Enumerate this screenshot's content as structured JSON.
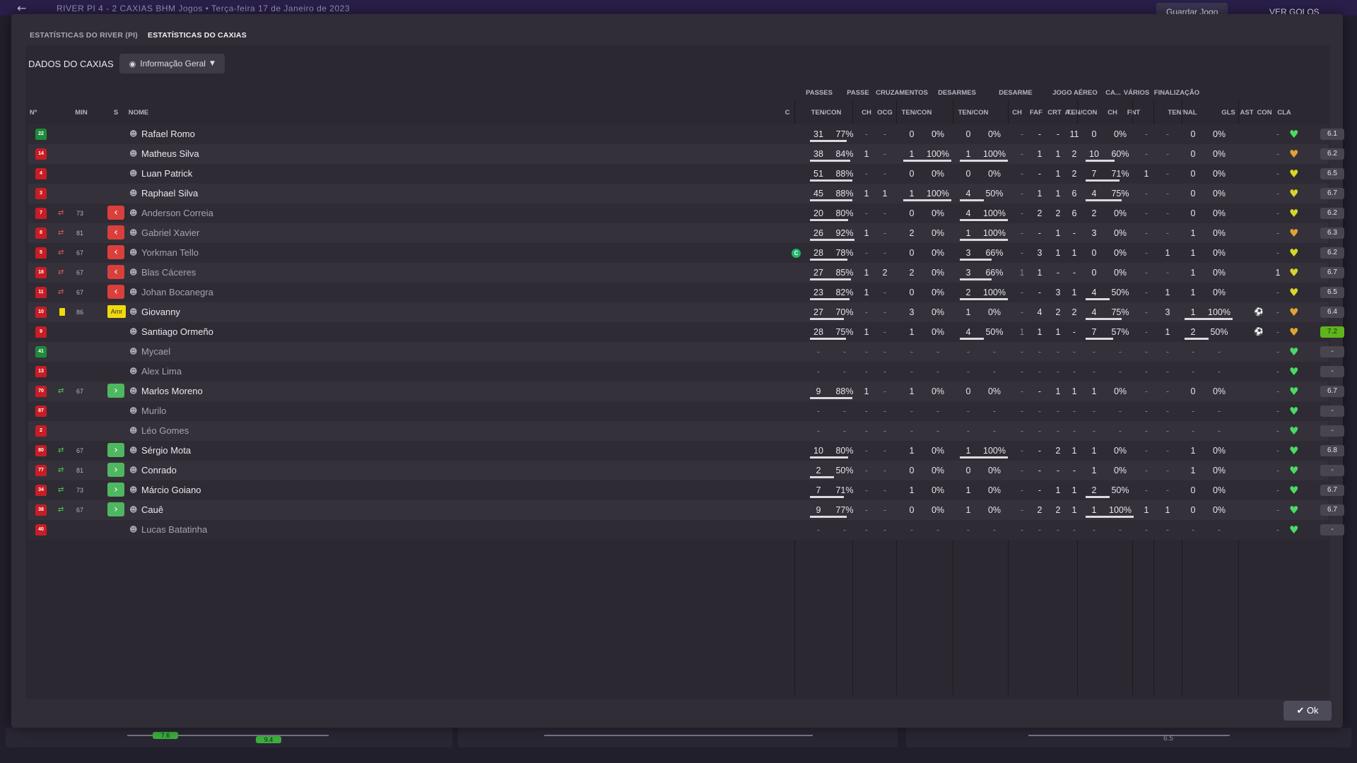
{
  "topbar": {
    "back_glyph": "←",
    "match": "RIVER PI  4 - 2  CAXIAS   BHM Jogos   •   Terça-feira 17 de Janeiro de 2023",
    "save_label": "Guardar Jogo",
    "goals_label": "VER GOLOS"
  },
  "tabs": [
    "ESTATÍSTICAS DO RIVER (PI)",
    "ESTATÍSTICAS DO CAXIAS"
  ],
  "subheader": {
    "title": "DADOS DO CAXIAS",
    "view_select": "Informação Geral"
  },
  "groups": [
    "PASSES",
    "PASSE",
    "CRUZAMENTOS",
    "DESARMES",
    "DESARME",
    "JOGO AÉREO",
    "CA...",
    "VÁRIOS",
    "FINALIZAÇÃO"
  ],
  "headers": {
    "no": "Nº",
    "min": "MIN",
    "s": "S",
    "name": "NOME",
    "c": "C",
    "passes_tc": "TEN/CON",
    "passe_ch": "CH",
    "passe_ocg": "OCG",
    "cruz_tc": "TEN/CON",
    "des_tc": "TEN/CON",
    "d_ch": "CH",
    "d_faf": "FAF",
    "d_crt": "CRT",
    "d_a": "A...",
    "aer_tc": "TEN/CON",
    "ca_ch": "CH",
    "var_fnt": "FNT",
    "fin_tn": "TEN/NAL",
    "gls": "GLS",
    "ast": "AST",
    "con": "CON",
    "cla": "CLA"
  },
  "players": [
    {
      "num": "22",
      "shirt": "green",
      "sub": "",
      "min": "",
      "s": "",
      "name": "Rafael Romo",
      "cap": false,
      "pass": [
        "31",
        "77%"
      ],
      "pch": "-",
      "pocg": "-",
      "cruz": [
        "0",
        "0%"
      ],
      "des": [
        "0",
        "0%"
      ],
      "dch": "-",
      "dfaf": "-",
      "dcrt": "-",
      "da": "11",
      "aer": [
        "0",
        "0%"
      ],
      "cach": "-",
      "fnt": "-",
      "fin": [
        "0",
        "0%"
      ],
      "gls": "",
      "ast": "-",
      "con": "green",
      "cla": "6.1",
      "active": true
    },
    {
      "num": "14",
      "shirt": "red",
      "sub": "",
      "min": "",
      "s": "",
      "name": "Matheus Silva",
      "cap": false,
      "pass": [
        "38",
        "84%"
      ],
      "pch": "1",
      "pocg": "-",
      "cruz": [
        "1",
        "100%"
      ],
      "des": [
        "1",
        "100%"
      ],
      "dch": "-",
      "dfaf": "1",
      "dcrt": "1",
      "da": "2",
      "aer": [
        "10",
        "60%"
      ],
      "cach": "-",
      "fnt": "-",
      "fin": [
        "0",
        "0%"
      ],
      "gls": "",
      "ast": "-",
      "con": "orange",
      "cla": "6.2",
      "active": true
    },
    {
      "num": "4",
      "shirt": "red",
      "sub": "",
      "min": "",
      "s": "",
      "name": "Luan Patrick",
      "cap": false,
      "pass": [
        "51",
        "88%"
      ],
      "pch": "-",
      "pocg": "-",
      "cruz": [
        "0",
        "0%"
      ],
      "des": [
        "0",
        "0%"
      ],
      "dch": "-",
      "dfaf": "-",
      "dcrt": "1",
      "da": "2",
      "aer": [
        "7",
        "71%"
      ],
      "cach": "1",
      "fnt": "-",
      "fin": [
        "0",
        "0%"
      ],
      "gls": "",
      "ast": "-",
      "con": "yellow",
      "cla": "6.5",
      "active": true
    },
    {
      "num": "3",
      "shirt": "red",
      "sub": "",
      "min": "",
      "s": "",
      "name": "Raphael Silva",
      "cap": false,
      "pass": [
        "45",
        "88%"
      ],
      "pch": "1",
      "pocg": "1",
      "cruz": [
        "1",
        "100%"
      ],
      "des": [
        "4",
        "50%"
      ],
      "dch": "-",
      "dfaf": "1",
      "dcrt": "1",
      "da": "6",
      "aer": [
        "4",
        "75%"
      ],
      "cach": "-",
      "fnt": "-",
      "fin": [
        "0",
        "0%"
      ],
      "gls": "",
      "ast": "-",
      "con": "yellow",
      "cla": "6.7",
      "active": true
    },
    {
      "num": "7",
      "shirt": "red",
      "sub": "out",
      "min": "73",
      "s": "out",
      "name": "Anderson Correia",
      "cap": false,
      "pass": [
        "20",
        "80%"
      ],
      "pch": "-",
      "pocg": "-",
      "cruz": [
        "0",
        "0%"
      ],
      "des": [
        "4",
        "100%"
      ],
      "dch": "-",
      "dfaf": "2",
      "dcrt": "2",
      "da": "6",
      "aer": [
        "2",
        "0%"
      ],
      "cach": "-",
      "fnt": "-",
      "fin": [
        "0",
        "0%"
      ],
      "gls": "",
      "ast": "-",
      "con": "yellow",
      "cla": "6.2",
      "active": false
    },
    {
      "num": "8",
      "shirt": "red",
      "sub": "out",
      "min": "81",
      "s": "out",
      "name": "Gabriel Xavier",
      "cap": false,
      "pass": [
        "26",
        "92%"
      ],
      "pch": "1",
      "pocg": "-",
      "cruz": [
        "2",
        "0%"
      ],
      "des": [
        "1",
        "100%"
      ],
      "dch": "-",
      "dfaf": "-",
      "dcrt": "1",
      "da": "-",
      "aer": [
        "3",
        "0%"
      ],
      "cach": "-",
      "fnt": "-",
      "fin": [
        "1",
        "0%"
      ],
      "gls": "",
      "ast": "-",
      "con": "orange",
      "cla": "6.3",
      "active": false
    },
    {
      "num": "5",
      "shirt": "red",
      "sub": "out",
      "min": "67",
      "s": "out",
      "name": "Yorkman Tello",
      "cap": true,
      "pass": [
        "28",
        "78%"
      ],
      "pch": "-",
      "pocg": "-",
      "cruz": [
        "0",
        "0%"
      ],
      "des": [
        "3",
        "66%"
      ],
      "dch": "-",
      "dfaf": "3",
      "dcrt": "1",
      "da": "1",
      "aer": [
        "0",
        "0%"
      ],
      "cach": "-",
      "fnt": "1",
      "fin": [
        "1",
        "0%"
      ],
      "gls": "",
      "ast": "-",
      "con": "yellow",
      "cla": "6.2",
      "active": false
    },
    {
      "num": "18",
      "shirt": "red",
      "sub": "out",
      "min": "67",
      "s": "out",
      "name": "Blas Cáceres",
      "cap": false,
      "pass": [
        "27",
        "85%"
      ],
      "pch": "1",
      "pocg": "2",
      "cruz": [
        "2",
        "0%"
      ],
      "des": [
        "3",
        "66%"
      ],
      "dch": "1",
      "dfaf": "1",
      "dcrt": "-",
      "da": "-",
      "aer": [
        "0",
        "0%"
      ],
      "cach": "-",
      "fnt": "-",
      "fin": [
        "1",
        "0%"
      ],
      "gls": "",
      "ast": "1",
      "con": "yellow",
      "cla": "6.7",
      "active": false
    },
    {
      "num": "11",
      "shirt": "red",
      "sub": "out",
      "min": "67",
      "s": "out",
      "name": "Johan Bocanegra",
      "cap": false,
      "pass": [
        "23",
        "82%"
      ],
      "pch": "1",
      "pocg": "-",
      "cruz": [
        "0",
        "0%"
      ],
      "des": [
        "2",
        "100%"
      ],
      "dch": "-",
      "dfaf": "-",
      "dcrt": "3",
      "da": "1",
      "aer": [
        "4",
        "50%"
      ],
      "cach": "-",
      "fnt": "1",
      "fin": [
        "1",
        "0%"
      ],
      "gls": "",
      "ast": "-",
      "con": "yellow",
      "cla": "6.5",
      "active": false
    },
    {
      "num": "10",
      "shirt": "red",
      "sub": "card",
      "min": "86",
      "s": "amr",
      "name": "Giovanny",
      "cap": false,
      "pass": [
        "27",
        "70%"
      ],
      "pch": "-",
      "pocg": "-",
      "cruz": [
        "3",
        "0%"
      ],
      "des": [
        "1",
        "0%"
      ],
      "dch": "-",
      "dfaf": "4",
      "dcrt": "2",
      "da": "2",
      "aer": [
        "4",
        "75%"
      ],
      "cach": "-",
      "fnt": "3",
      "fin": [
        "1",
        "100%"
      ],
      "gls": "ball",
      "ast": "-",
      "con": "orange",
      "cla": "6.4",
      "active": true
    },
    {
      "num": "9",
      "shirt": "red",
      "sub": "",
      "min": "",
      "s": "",
      "name": "Santiago Ormeño",
      "cap": false,
      "pass": [
        "28",
        "75%"
      ],
      "pch": "1",
      "pocg": "-",
      "cruz": [
        "1",
        "0%"
      ],
      "des": [
        "4",
        "50%"
      ],
      "dch": "1",
      "dfaf": "1",
      "dcrt": "1",
      "da": "-",
      "aer": [
        "7",
        "57%"
      ],
      "cach": "-",
      "fnt": "1",
      "fin": [
        "2",
        "50%"
      ],
      "gls": "ball",
      "ast": "-",
      "con": "orange",
      "cla": "7.2",
      "best": true,
      "active": true
    },
    {
      "num": "41",
      "shirt": "green",
      "sub": "",
      "min": "",
      "s": "",
      "name": "Mycael",
      "cap": false,
      "empty": true,
      "con": "green",
      "cla": "-",
      "active": false
    },
    {
      "num": "13",
      "shirt": "red",
      "sub": "",
      "min": "",
      "s": "",
      "name": "Alex Lima",
      "cap": false,
      "empty": true,
      "con": "green",
      "cla": "-",
      "active": false
    },
    {
      "num": "70",
      "shirt": "red",
      "sub": "in",
      "min": "67",
      "s": "in",
      "name": "Marlos Moreno",
      "cap": false,
      "pass": [
        "9",
        "88%"
      ],
      "pch": "1",
      "pocg": "-",
      "cruz": [
        "1",
        "0%"
      ],
      "des": [
        "0",
        "0%"
      ],
      "dch": "-",
      "dfaf": "-",
      "dcrt": "1",
      "da": "1",
      "aer": [
        "1",
        "0%"
      ],
      "cach": "-",
      "fnt": "-",
      "fin": [
        "0",
        "0%"
      ],
      "gls": "",
      "ast": "-",
      "con": "green",
      "cla": "6.7",
      "active": true
    },
    {
      "num": "87",
      "shirt": "red",
      "sub": "",
      "min": "",
      "s": "",
      "name": "Murilo",
      "cap": false,
      "empty": true,
      "con": "green",
      "cla": "-",
      "active": false
    },
    {
      "num": "2",
      "shirt": "red",
      "sub": "",
      "min": "",
      "s": "",
      "name": "Léo Gomes",
      "cap": false,
      "empty": true,
      "con": "green",
      "cla": "-",
      "active": false
    },
    {
      "num": "80",
      "shirt": "red",
      "sub": "in",
      "min": "67",
      "s": "in",
      "name": "Sérgio Mota",
      "cap": false,
      "pass": [
        "10",
        "80%"
      ],
      "pch": "-",
      "pocg": "-",
      "cruz": [
        "1",
        "0%"
      ],
      "des": [
        "1",
        "100%"
      ],
      "dch": "-",
      "dfaf": "-",
      "dcrt": "2",
      "da": "1",
      "aer": [
        "1",
        "0%"
      ],
      "cach": "-",
      "fnt": "-",
      "fin": [
        "1",
        "0%"
      ],
      "gls": "",
      "ast": "-",
      "con": "green",
      "cla": "6.8",
      "active": true
    },
    {
      "num": "77",
      "shirt": "red",
      "sub": "in",
      "min": "81",
      "s": "in",
      "name": "Conrado",
      "cap": false,
      "pass": [
        "2",
        "50%"
      ],
      "pch": "-",
      "pocg": "-",
      "cruz": [
        "0",
        "0%"
      ],
      "des": [
        "0",
        "0%"
      ],
      "dch": "-",
      "dfaf": "-",
      "dcrt": "-",
      "da": "-",
      "aer": [
        "1",
        "0%"
      ],
      "cach": "-",
      "fnt": "-",
      "fin": [
        "1",
        "0%"
      ],
      "gls": "",
      "ast": "-",
      "con": "green",
      "cla": "-",
      "active": true
    },
    {
      "num": "34",
      "shirt": "red",
      "sub": "in",
      "min": "73",
      "s": "in",
      "name": "Márcio Goiano",
      "cap": false,
      "pass": [
        "7",
        "71%"
      ],
      "pch": "-",
      "pocg": "-",
      "cruz": [
        "1",
        "0%"
      ],
      "des": [
        "1",
        "0%"
      ],
      "dch": "-",
      "dfaf": "-",
      "dcrt": "1",
      "da": "1",
      "aer": [
        "2",
        "50%"
      ],
      "cach": "-",
      "fnt": "-",
      "fin": [
        "0",
        "0%"
      ],
      "gls": "",
      "ast": "-",
      "con": "green",
      "cla": "6.7",
      "active": true
    },
    {
      "num": "38",
      "shirt": "red",
      "sub": "in",
      "min": "67",
      "s": "in",
      "name": "Cauê",
      "cap": false,
      "pass": [
        "9",
        "77%"
      ],
      "pch": "-",
      "pocg": "-",
      "cruz": [
        "0",
        "0%"
      ],
      "des": [
        "1",
        "0%"
      ],
      "dch": "-",
      "dfaf": "2",
      "dcrt": "2",
      "da": "1",
      "aer": [
        "1",
        "100%"
      ],
      "cach": "1",
      "fnt": "1",
      "fin": [
        "0",
        "0%"
      ],
      "gls": "",
      "ast": "-",
      "con": "green",
      "cla": "6.7",
      "active": true
    },
    {
      "num": "40",
      "shirt": "red",
      "sub": "",
      "min": "",
      "s": "",
      "name": "Lucas Batatinha",
      "cap": false,
      "empty": true,
      "con": "green",
      "cla": "-",
      "active": false
    }
  ],
  "s_labels": {
    "amr": "Amr"
  },
  "captain_letter": "C",
  "ok_label": "✔ Ok",
  "bottom": {
    "left_val1": "7.6",
    "left_val2": "9.4",
    "right_label": "6.5"
  },
  "colors": {
    "con_green": "#4cd964",
    "con_yellow": "#d8d42a",
    "con_orange": "#e0a236",
    "accent_green": "#5fb51c",
    "shirt_red": "#c81d25"
  }
}
